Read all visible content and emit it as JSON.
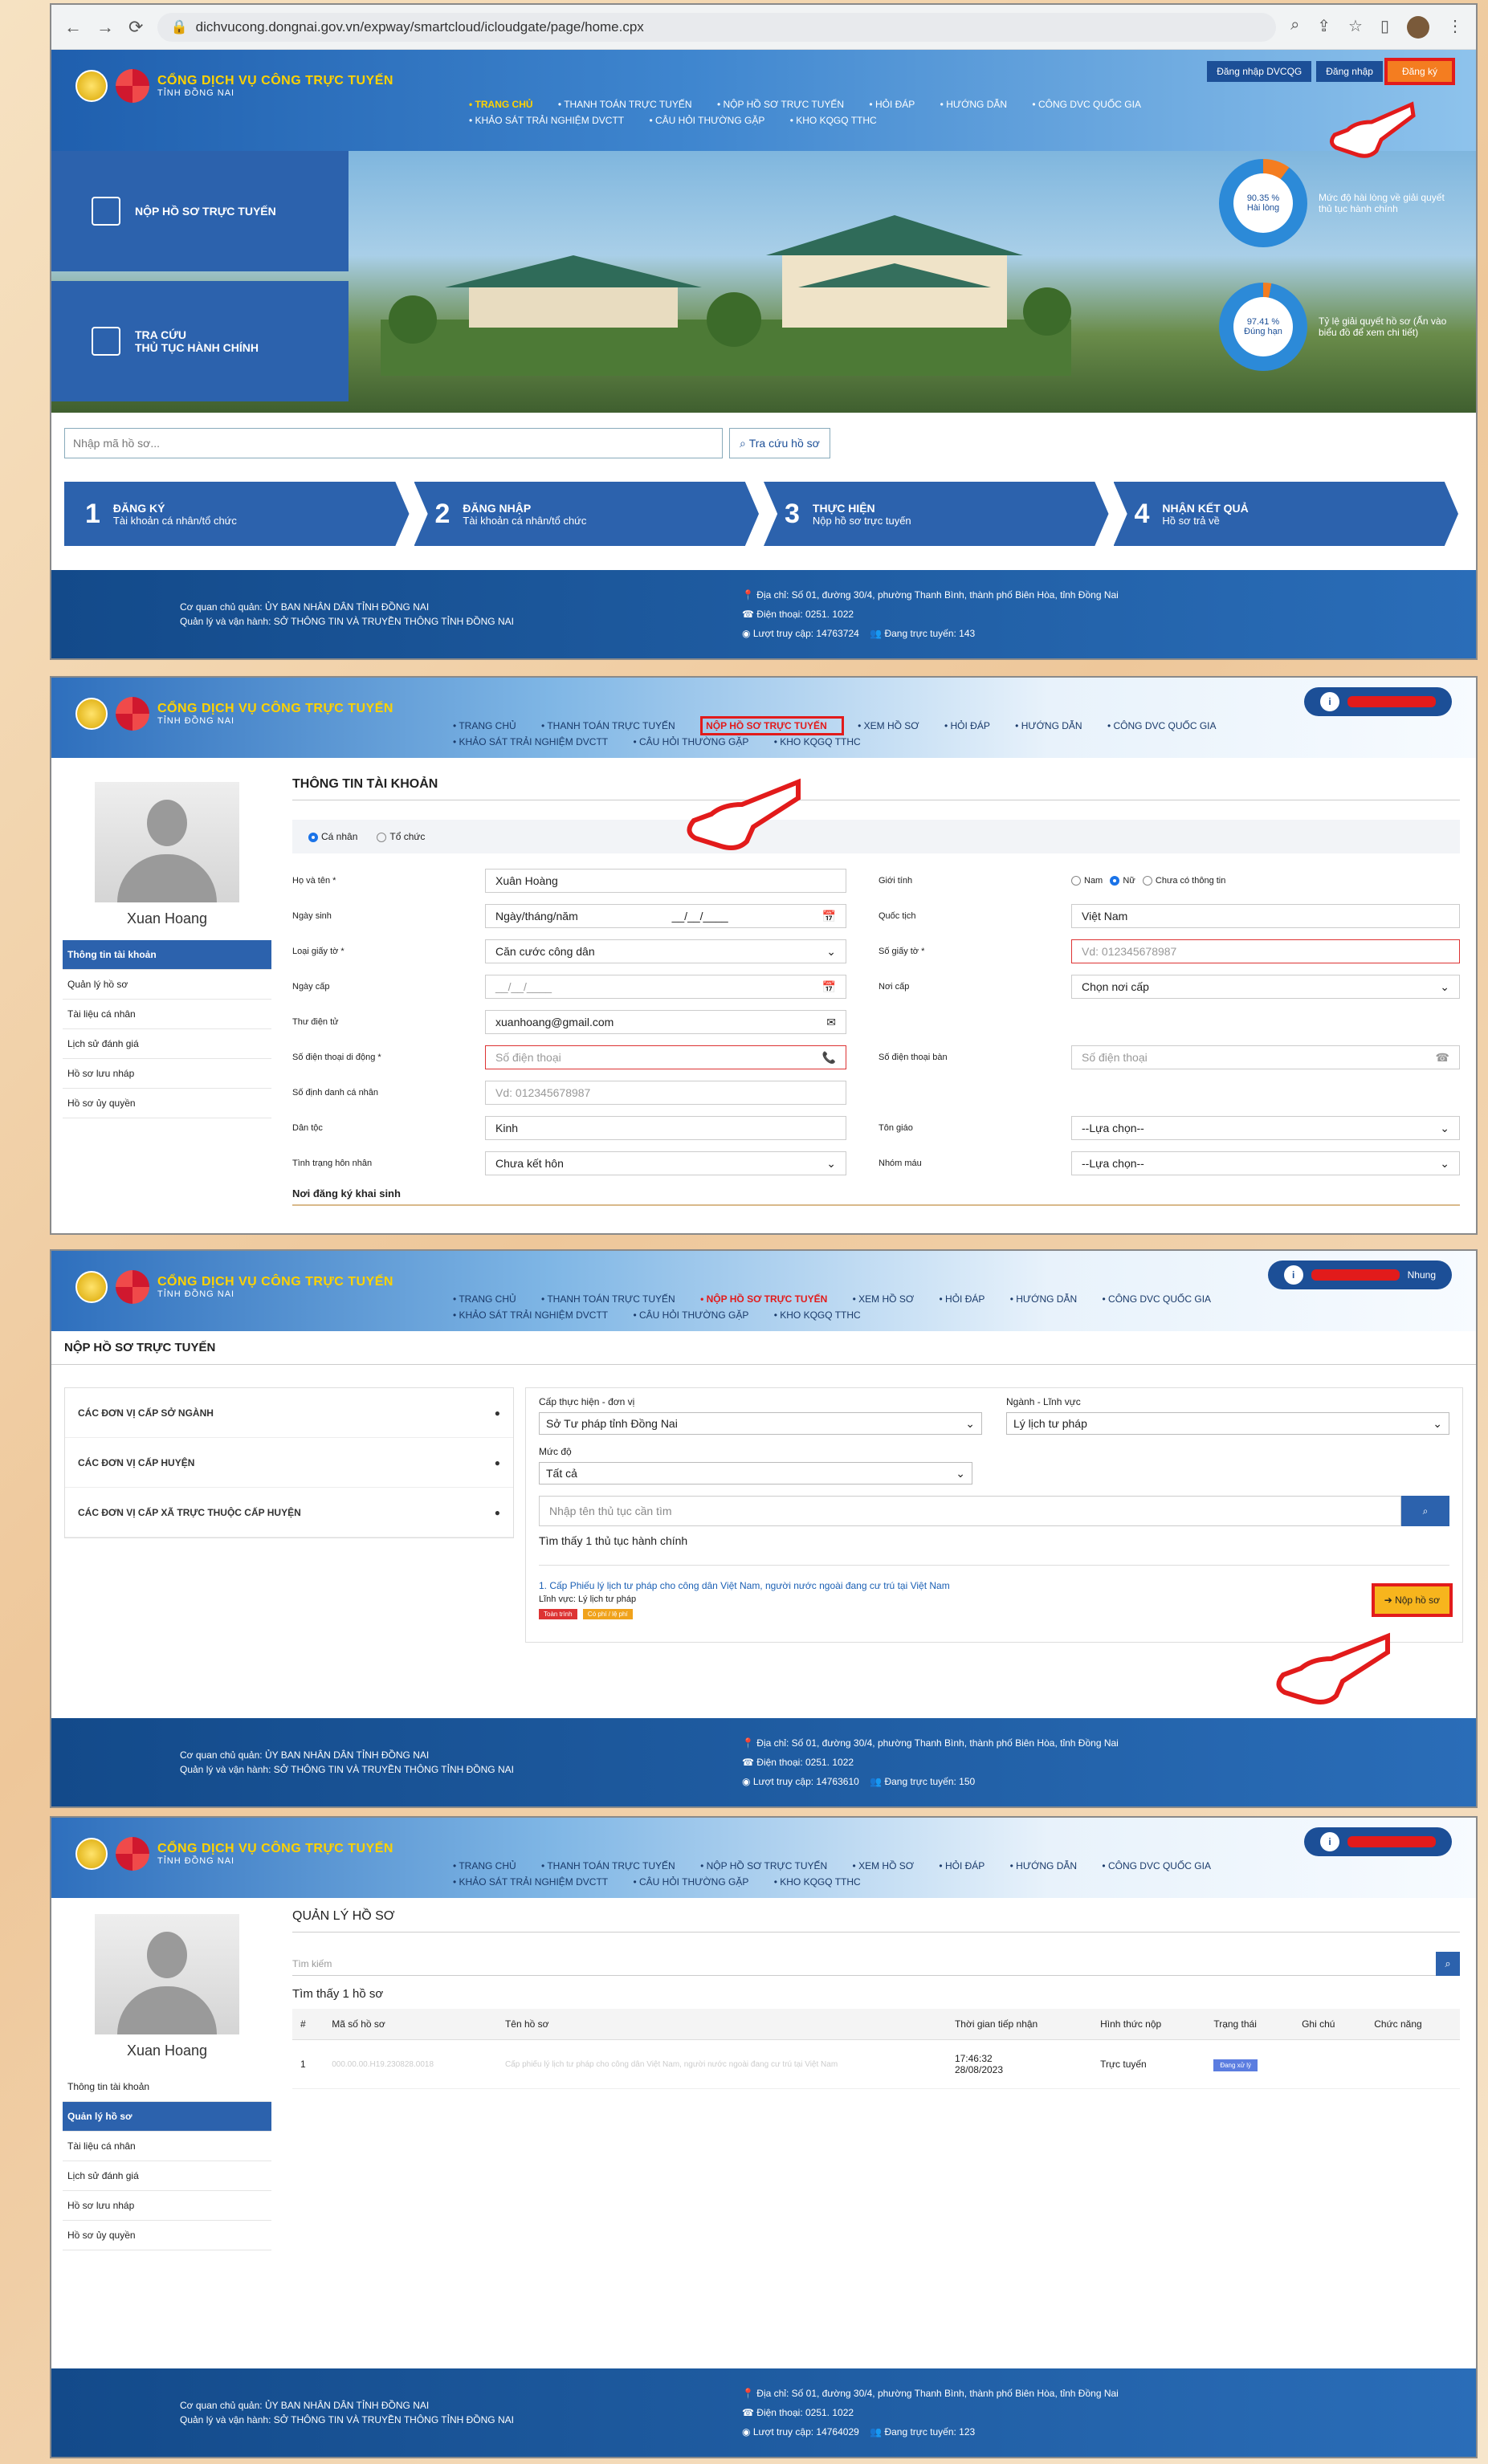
{
  "browser": {
    "url": "dichvucong.dongnai.gov.vn/expway/smartcloud/icloudgate/page/home.cpx"
  },
  "site": {
    "title": "CỔNG DỊCH VỤ CÔNG TRỰC TUYẾN",
    "subtitle": "TỈNH ĐỒNG NAI",
    "menu": [
      "TRANG CHỦ",
      "THANH TOÁN TRỰC TUYẾN",
      "NỘP HỒ SƠ TRỰC TUYẾN",
      "HỎI ĐÁP",
      "HƯỚNG DẪN",
      "CÔNG DVC QUỐC GIA",
      "KHẢO SÁT TRẢI NGHIỆM DVCTT",
      "CÂU HỎI THƯỜNG GẶP",
      "KHO KQGQ TTHC"
    ],
    "menu2": [
      "TRANG CHỦ",
      "THANH TOÁN TRỰC TUYẾN",
      "NỘP HỒ SƠ TRỰC TUYẾN",
      "XEM HỒ SƠ",
      "HỎI ĐÁP",
      "HƯỚNG DẪN",
      "CÔNG DVC QUỐC GIA",
      "KHẢO SÁT TRẢI NGHIỆM DVCTT",
      "CÂU HỎI THƯỜNG GẶP",
      "KHO KQGQ TTHC"
    ],
    "login_dvcqg": "Đăng nhập DVCQG",
    "login": "Đăng nhập",
    "register": "Đăng ký",
    "user_suffix": "Nhung"
  },
  "home": {
    "side1": "NỘP HỒ SƠ TRỰC TUYẾN",
    "side2a": "TRA CỨU",
    "side2b": "THỦ TỤC HÀNH CHÍNH",
    "stat1_value": "90.35 %",
    "stat1_sub": "Hài lòng",
    "stat1_text": "Mức độ hài lòng về giải quyết thủ tục hành chính",
    "stat2_value": "97.41 %",
    "stat2_sub": "Đúng hạn",
    "stat2_text": "Tỷ lệ giải quyết hồ sơ (Ấn vào biểu đồ để xem chi tiết)",
    "search_placeholder": "Nhập mã hồ sơ...",
    "search_button": "Tra cứu hồ sơ",
    "steps": [
      {
        "n": "1",
        "t": "ĐĂNG KÝ",
        "s": "Tài khoản cá nhân/tổ chức"
      },
      {
        "n": "2",
        "t": "ĐĂNG NHẬP",
        "s": "Tài khoản cá nhân/tổ chức"
      },
      {
        "n": "3",
        "t": "THỰC HIỆN",
        "s": "Nộp hồ sơ trực tuyến"
      },
      {
        "n": "4",
        "t": "NHẬN KẾT QUẢ",
        "s": "Hồ sơ trả về"
      }
    ]
  },
  "footer": {
    "org1": "Cơ quan chủ quản: ỦY BAN NHÂN DÂN TỈNH ĐỒNG NAI",
    "org2": "Quản lý và vận hành: SỞ THÔNG TIN VÀ TRUYỀN THÔNG TỈNH ĐỒNG NAI",
    "address": "Địa chỉ: Số 01, đường 30/4, phường Thanh Bình, thành phố Biên Hòa, tỉnh Đồng Nai",
    "phone": "Điện thoại: 0251. 1022",
    "visits1": "Lượt truy cập: 14763724",
    "online1": "Đang trực tuyến: 143",
    "visits2": "Lượt truy cập: 14763610",
    "online2": "Đang trực tuyến: 150",
    "visits3": "Lượt truy cập: 14764029",
    "online3": "Đang trực tuyến: 123"
  },
  "account": {
    "name": "Xuan Hoang",
    "nav": [
      "Thông tin tài khoản",
      "Quản lý hồ sơ",
      "Tài liệu cá nhân",
      "Lịch sử đánh giá",
      "Hồ sơ lưu nháp",
      "Hồ sơ ủy quyền"
    ],
    "title": "THÔNG TIN TÀI KHOẢN",
    "personal": "Cá nhân",
    "org": "Tổ chức",
    "fields": {
      "fullname_l": "Họ và tên *",
      "fullname_v": "Xuân Hoàng",
      "gender_l": "Giới tính",
      "male": "Nam",
      "female": "Nữ",
      "unknown": "Chưa có thông tin",
      "dob_l": "Ngày sinh",
      "dob_v": "Ngày/tháng/năm",
      "dob_v2": "__/__/____",
      "nation_l": "Quốc tịch",
      "nation_v": "Việt Nam",
      "idtype_l": "Loại giấy tờ *",
      "idtype_v": "Căn cước công dân",
      "idno_l": "Số giấy tờ *",
      "idno_v": "Vd: 012345678987",
      "issue_l": "Ngày cấp",
      "issue_v": "__/__/____",
      "place_l": "Nơi cấp",
      "place_v": "Chọn nơi cấp",
      "email_l": "Thư điện tử",
      "email_v": "xuanhoang@gmail.com",
      "mobile_l": "Số điện thoại di động *",
      "mobile_v": "Số điện thoại",
      "phone_l": "Số điện thoại bàn",
      "phone_v": "Số điện thoại",
      "pid_l": "Số định danh cá nhân",
      "pid_v": "Vd: 012345678987",
      "ethnic_l": "Dân tộc",
      "ethnic_v": "Kinh",
      "religion_l": "Tôn giáo",
      "religion_v": "--Lựa chọn--",
      "marital_l": "Tình trạng hôn nhân",
      "marital_v": "Chưa kết hôn",
      "blood_l": "Nhóm máu",
      "blood_v": "--Lựa chọn--",
      "reg": "Nơi đăng ký khai sinh"
    }
  },
  "procedures": {
    "crumb": "NỘP HỒ SƠ TRỰC TUYẾN",
    "units": [
      "CÁC ĐƠN VỊ CẤP SỞ NGÀNH",
      "CÁC ĐƠN VỊ CẤP HUYỆN",
      "CÁC ĐƠN VỊ CẤP XÃ TRỰC THUỘC CẤP HUYỆN"
    ],
    "level_l": "Cấp thực hiện - đơn vị",
    "level_v": "Sở Tư pháp tỉnh Đồng Nai",
    "field_l": "Ngành - Lĩnh vực",
    "field_v": "Lý lịch tư pháp",
    "degree_l": "Mức độ",
    "degree_v": "Tất cả",
    "search_ph": "Nhập tên thủ tục cần tìm",
    "found": "Tìm thấy 1 thủ tục hành chính",
    "item": "1.  Cấp Phiếu lý lịch tư pháp cho công dân Việt Nam, người nước ngoài đang cư trú tại Việt Nam",
    "item_field": "Lĩnh vực: Lý lịch tư pháp",
    "tag1": "Toàn trình",
    "tag2": "Có phí / lệ phí",
    "submit": "➔ Nộp hồ sơ"
  },
  "manage": {
    "title": "QUẢN LÝ HỒ SƠ",
    "search_ph": "Tìm kiếm",
    "found": "Tìm thấy 1 hồ sơ",
    "headers": [
      "#",
      "Mã số hồ sơ",
      "Tên hồ sơ",
      "Thời gian tiếp nhận",
      "Hình thức nộp",
      "Trạng thái",
      "Ghi chú",
      "Chức năng"
    ],
    "row": {
      "n": "1",
      "code": "000.00.00.H19.230828.0018",
      "name": "Cấp phiếu lý lịch tư pháp cho công dân Việt Nam, người nước ngoài đang cư trú tại Việt Nam",
      "time1": "17:46:32",
      "time2": "28/08/2023",
      "form": "Trực tuyến",
      "status": "Đang xử lý"
    }
  },
  "colors": {
    "primary": "#2c62ad",
    "accent": "#f47d20",
    "highlight": "#e21b1b"
  }
}
